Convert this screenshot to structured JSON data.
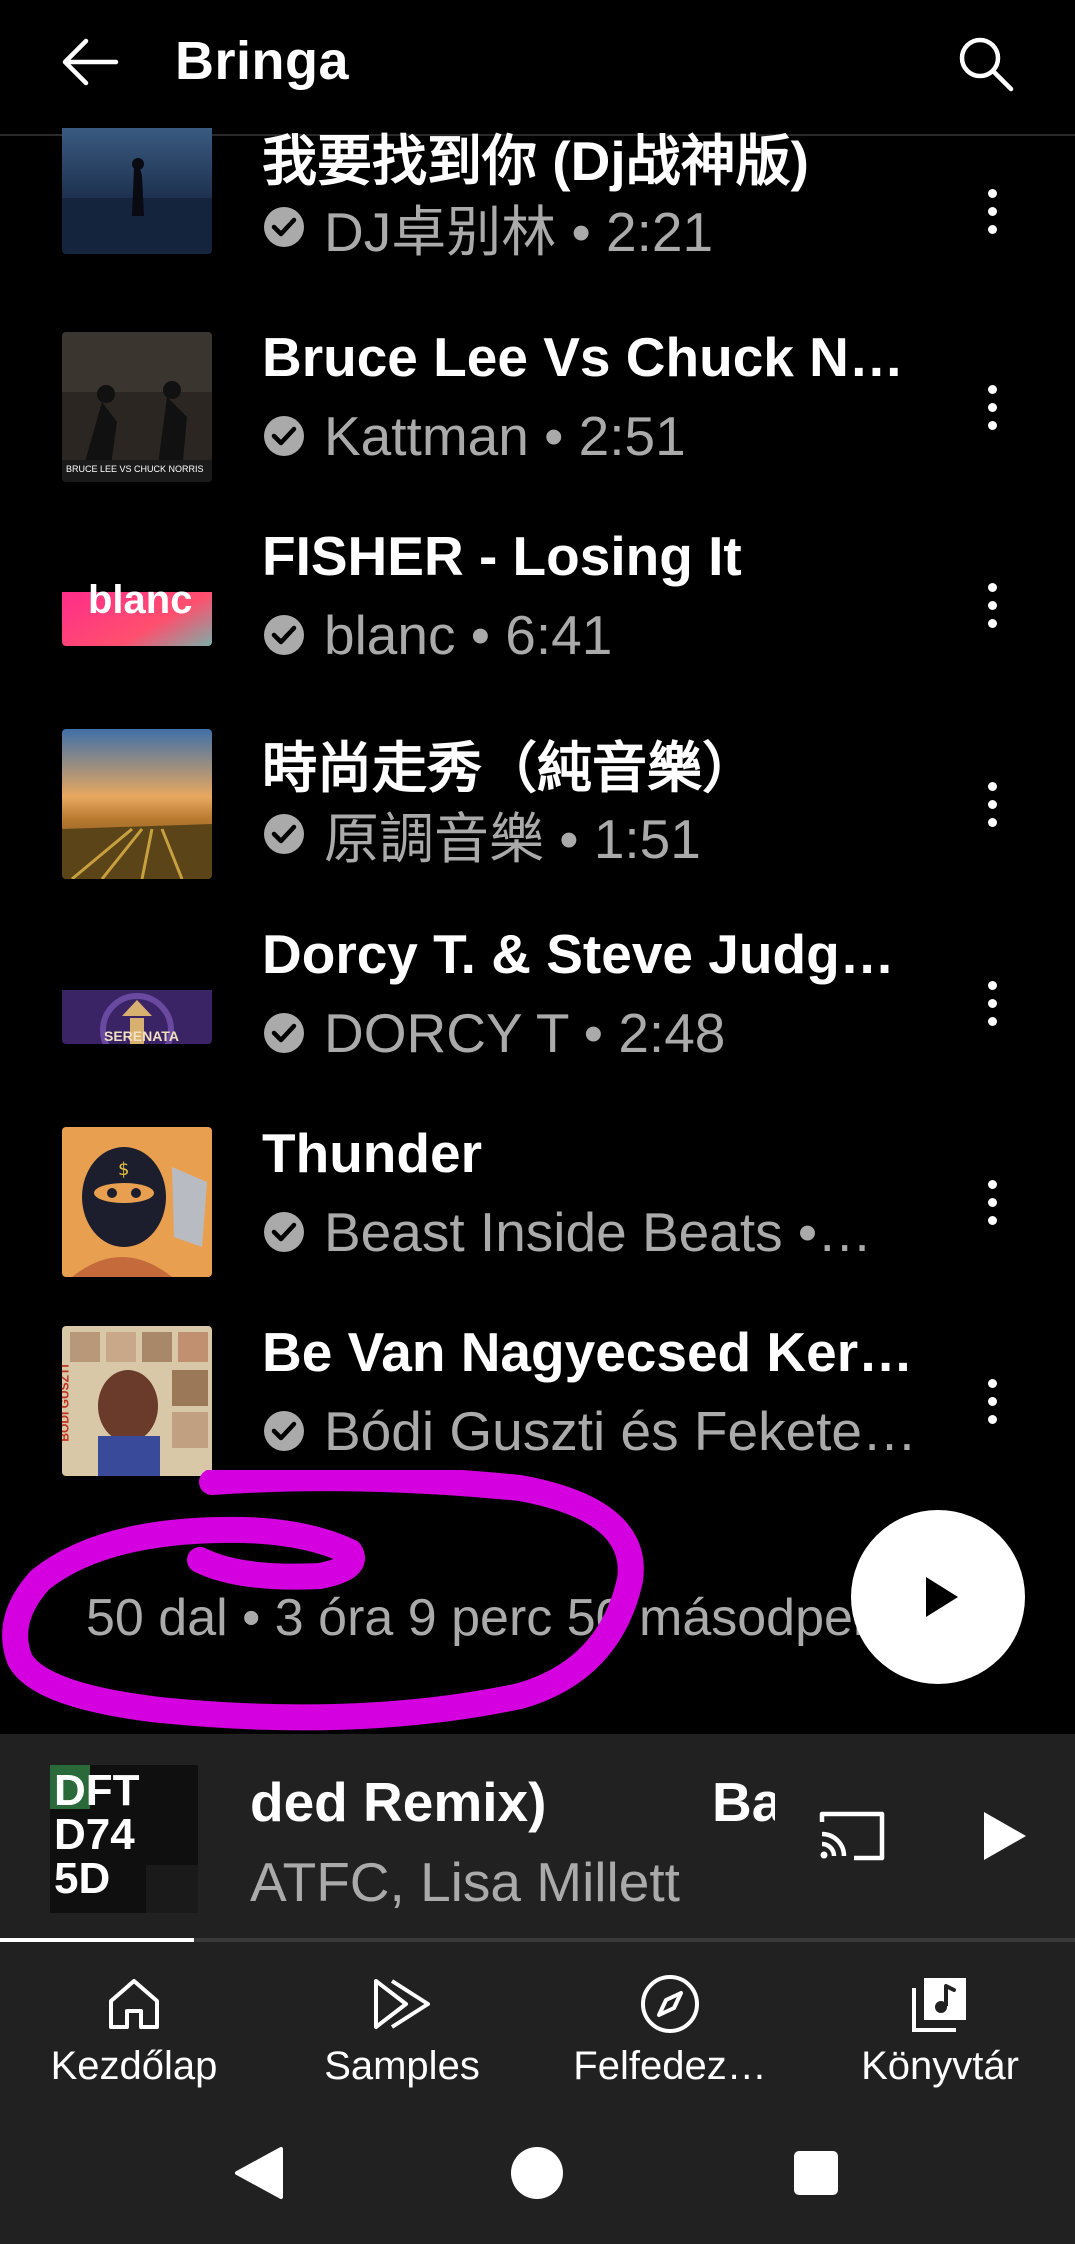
{
  "header": {
    "title": "Bringa",
    "back_icon": "arrow-left-icon",
    "search_icon": "search-icon"
  },
  "tracks": [
    {
      "title": "我要找到你 (Dj战神版)",
      "meta": "DJ卓别林 • 2:21"
    },
    {
      "title": "Bruce Lee Vs Chuck No…",
      "meta": "Kattman • 2:51"
    },
    {
      "title": "FISHER - Losing It",
      "meta": "blanc • 6:41"
    },
    {
      "title": "時尚走秀（純音樂）",
      "meta": "原調音樂 • 1:51"
    },
    {
      "title": "Dorcy T. & Steve Judge…",
      "meta": "DORCY T • 2:48"
    },
    {
      "title": "Thunder",
      "meta": "Beast Inside Beats •…"
    },
    {
      "title": "Be Van Nagyecsed Kerí…",
      "meta": "Bódi Guszti és Fekete…"
    }
  ],
  "thumb_text": {
    "t2": "BRUCE LEE VS CHUCK NORRIS",
    "t3": "blanc",
    "t5": "SERENATA",
    "t7": "BÓDI GUSZTI"
  },
  "summary": "50 dal • 3 óra 9 perc 50 másodperc",
  "mini_player": {
    "title": "ded Remix)",
    "title_next": "Ba",
    "artist": "ATFC, Lisa Millett",
    "cover_text": "DFT D74 5D",
    "progress": 0.18,
    "cast_icon": "cast-icon",
    "play_icon": "play-icon"
  },
  "nav": [
    {
      "label": "Kezdőlap",
      "icon": "home-icon"
    },
    {
      "label": "Samples",
      "icon": "samples-icon"
    },
    {
      "label": "Felfedez…",
      "icon": "compass-icon"
    },
    {
      "label": "Könyvtár",
      "icon": "library-icon"
    }
  ],
  "colors": {
    "background": "#000000",
    "surface": "#212121",
    "text_secondary": "#aaaaaa",
    "annotation": "#d400e0"
  }
}
